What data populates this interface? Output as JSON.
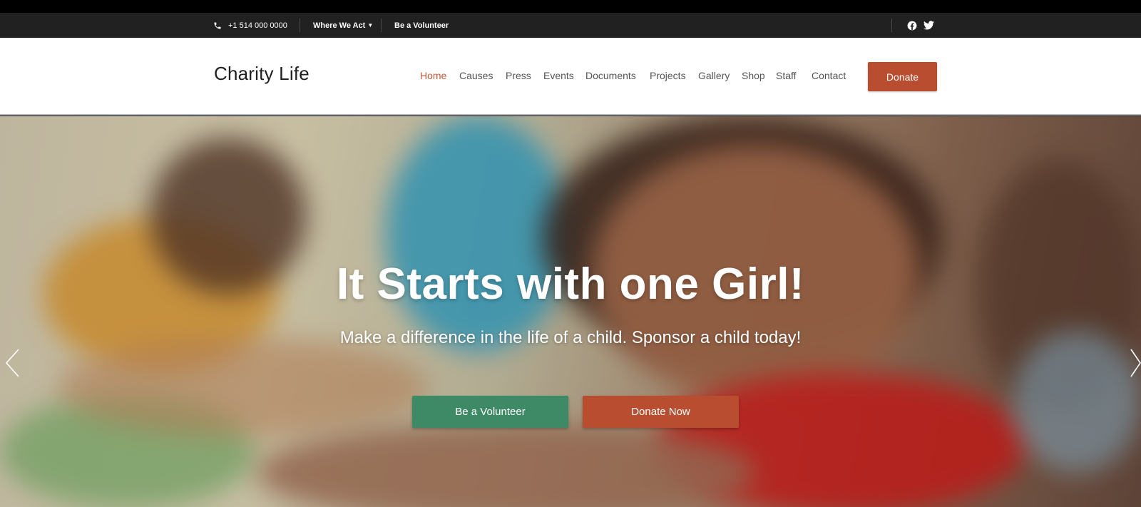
{
  "topbar": {
    "phone": "+1 514 000 0000",
    "where_we_act": "Where We Act",
    "be_volunteer": "Be a Volunteer",
    "social_icons": [
      "facebook-icon",
      "twitter-icon"
    ]
  },
  "header": {
    "logo": "Charity Life",
    "nav": [
      {
        "label": "Home",
        "active": true
      },
      {
        "label": "Causes"
      },
      {
        "label": "Press"
      },
      {
        "label": "Events"
      },
      {
        "label": "Documents"
      },
      {
        "label": "Projects"
      },
      {
        "label": "Gallery"
      },
      {
        "label": "Shop"
      },
      {
        "label": "Staff"
      },
      {
        "label": "Contact"
      }
    ],
    "donate": "Donate"
  },
  "hero": {
    "title": "It Starts with one Girl!",
    "subtitle": "Make a difference in the life of a child. Sponsor a child today!",
    "btn_volunteer": "Be a Volunteer",
    "btn_donate": "Donate Now"
  },
  "colors": {
    "accent": "#b84d2f",
    "green": "#3f8a66",
    "topbar": "#212121",
    "nav_active": "#c0583a"
  }
}
